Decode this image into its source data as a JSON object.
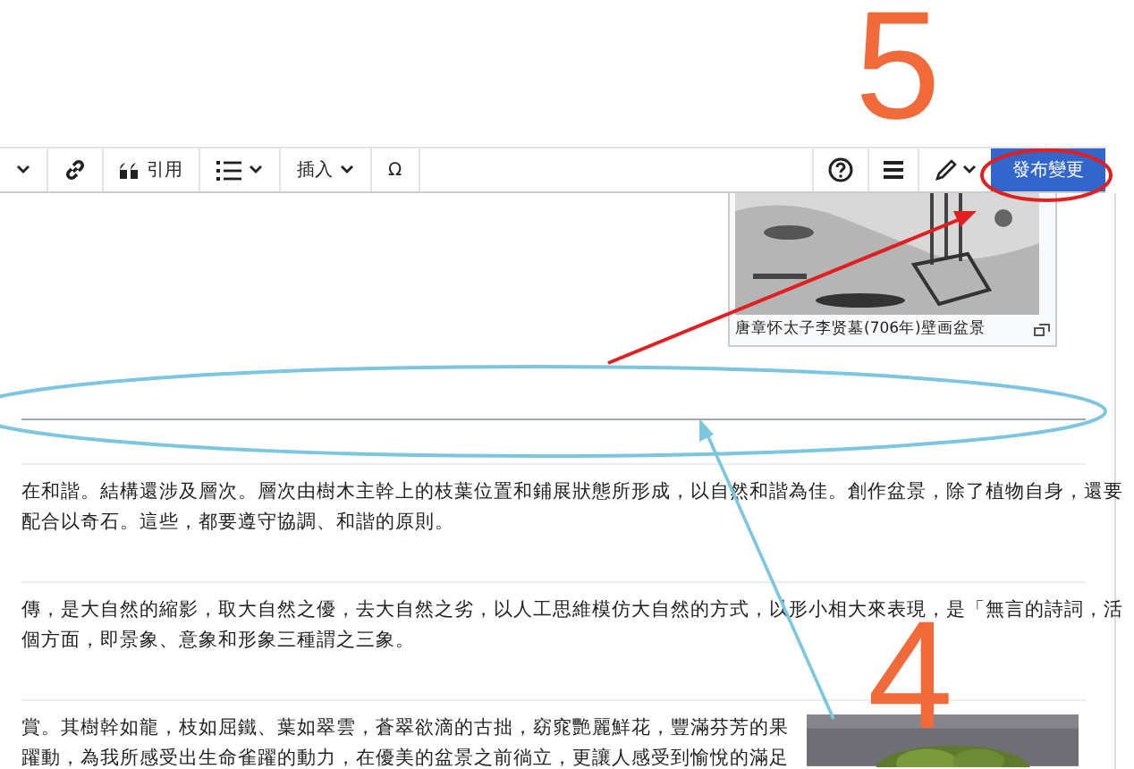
{
  "annotations": {
    "numbers": [
      {
        "text": "5",
        "kind": "top"
      },
      {
        "text": "4",
        "kind": "bottom"
      }
    ]
  },
  "toolbar": {
    "items": [
      {
        "kind": "dropdown"
      },
      {
        "kind": "link"
      },
      {
        "kind": "quote",
        "label": "引用"
      },
      {
        "kind": "list"
      },
      {
        "kind": "insert",
        "label": "插入"
      },
      {
        "kind": "special",
        "label": "Ω"
      }
    ],
    "right": [
      {
        "kind": "help"
      },
      {
        "kind": "menu"
      },
      {
        "kind": "edit"
      }
    ],
    "publish": "發布變更"
  },
  "figure": {
    "caption": "唐章怀太子李贤墓(706年)壁画盆景"
  },
  "paragraphs": [
    [
      "在和諧。結構還涉及層次。層次由樹木主幹上的枝葉位置和鋪展狀態所形成，以自然和諧為佳。創作盆景，除了植物自身，還要",
      "配合以奇石。這些，都要遵守協調、和諧的原則。"
    ],
    [
      "傳，是大自然的縮影，取大自然之優，去大自然之劣，以人工思維模仿大自然的方式，以形小相大來表現，是「無言的詩詞，活",
      "個方面，即景象、意象和形象三種謂之三象。"
    ],
    [
      "賞。其樹幹如龍，枝如屈鐵、葉如翠雲，蒼翠欲滴的古拙，窈窕艷麗鮮花，豐滿芬芳的果",
      "躍動，為我所感受出生命雀躍的動力，在優美的盆景之前徜立，更讓人感受到愉悅的滿足"
    ]
  ]
}
